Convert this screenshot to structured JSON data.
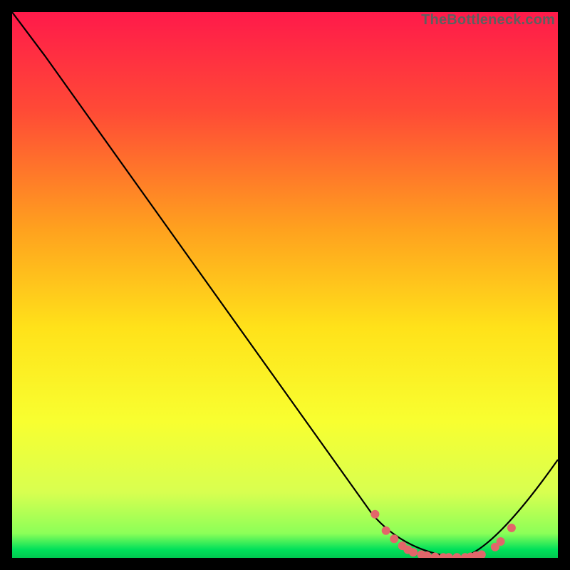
{
  "watermark": "TheBottleneck.com",
  "gradient": {
    "top": "#ff1a4a",
    "q1": "#ff6a2a",
    "mid": "#ffd21a",
    "q3": "#f5ff3a",
    "lower": "#d2ff5a",
    "bottom": "#00e05a"
  },
  "chart_data": {
    "type": "line",
    "title": "",
    "xlabel": "",
    "ylabel": "",
    "xlim": [
      0,
      100
    ],
    "ylim": [
      0,
      100
    ],
    "series": [
      {
        "name": "bottleneck-curve",
        "x": [
          0,
          6,
          66,
          72,
          82,
          88,
          100
        ],
        "y": [
          100,
          92,
          8,
          1,
          0,
          1,
          18
        ]
      }
    ],
    "markers": {
      "name": "highlight-dots",
      "color": "#e2666a",
      "points": [
        {
          "x": 66.5,
          "y": 8
        },
        {
          "x": 68.5,
          "y": 5
        },
        {
          "x": 70.0,
          "y": 3.5
        },
        {
          "x": 71.5,
          "y": 2.2
        },
        {
          "x": 72.5,
          "y": 1.5
        },
        {
          "x": 73.5,
          "y": 1.0
        },
        {
          "x": 75.0,
          "y": 0.6
        },
        {
          "x": 76.0,
          "y": 0.4
        },
        {
          "x": 77.5,
          "y": 0.2
        },
        {
          "x": 79.0,
          "y": 0.1
        },
        {
          "x": 80.0,
          "y": 0.1
        },
        {
          "x": 81.5,
          "y": 0.1
        },
        {
          "x": 83.0,
          "y": 0.1
        },
        {
          "x": 84.0,
          "y": 0.2
        },
        {
          "x": 85.0,
          "y": 0.4
        },
        {
          "x": 86.0,
          "y": 0.6
        },
        {
          "x": 88.5,
          "y": 2.0
        },
        {
          "x": 89.5,
          "y": 3.0
        },
        {
          "x": 91.5,
          "y": 5.5
        }
      ]
    }
  }
}
